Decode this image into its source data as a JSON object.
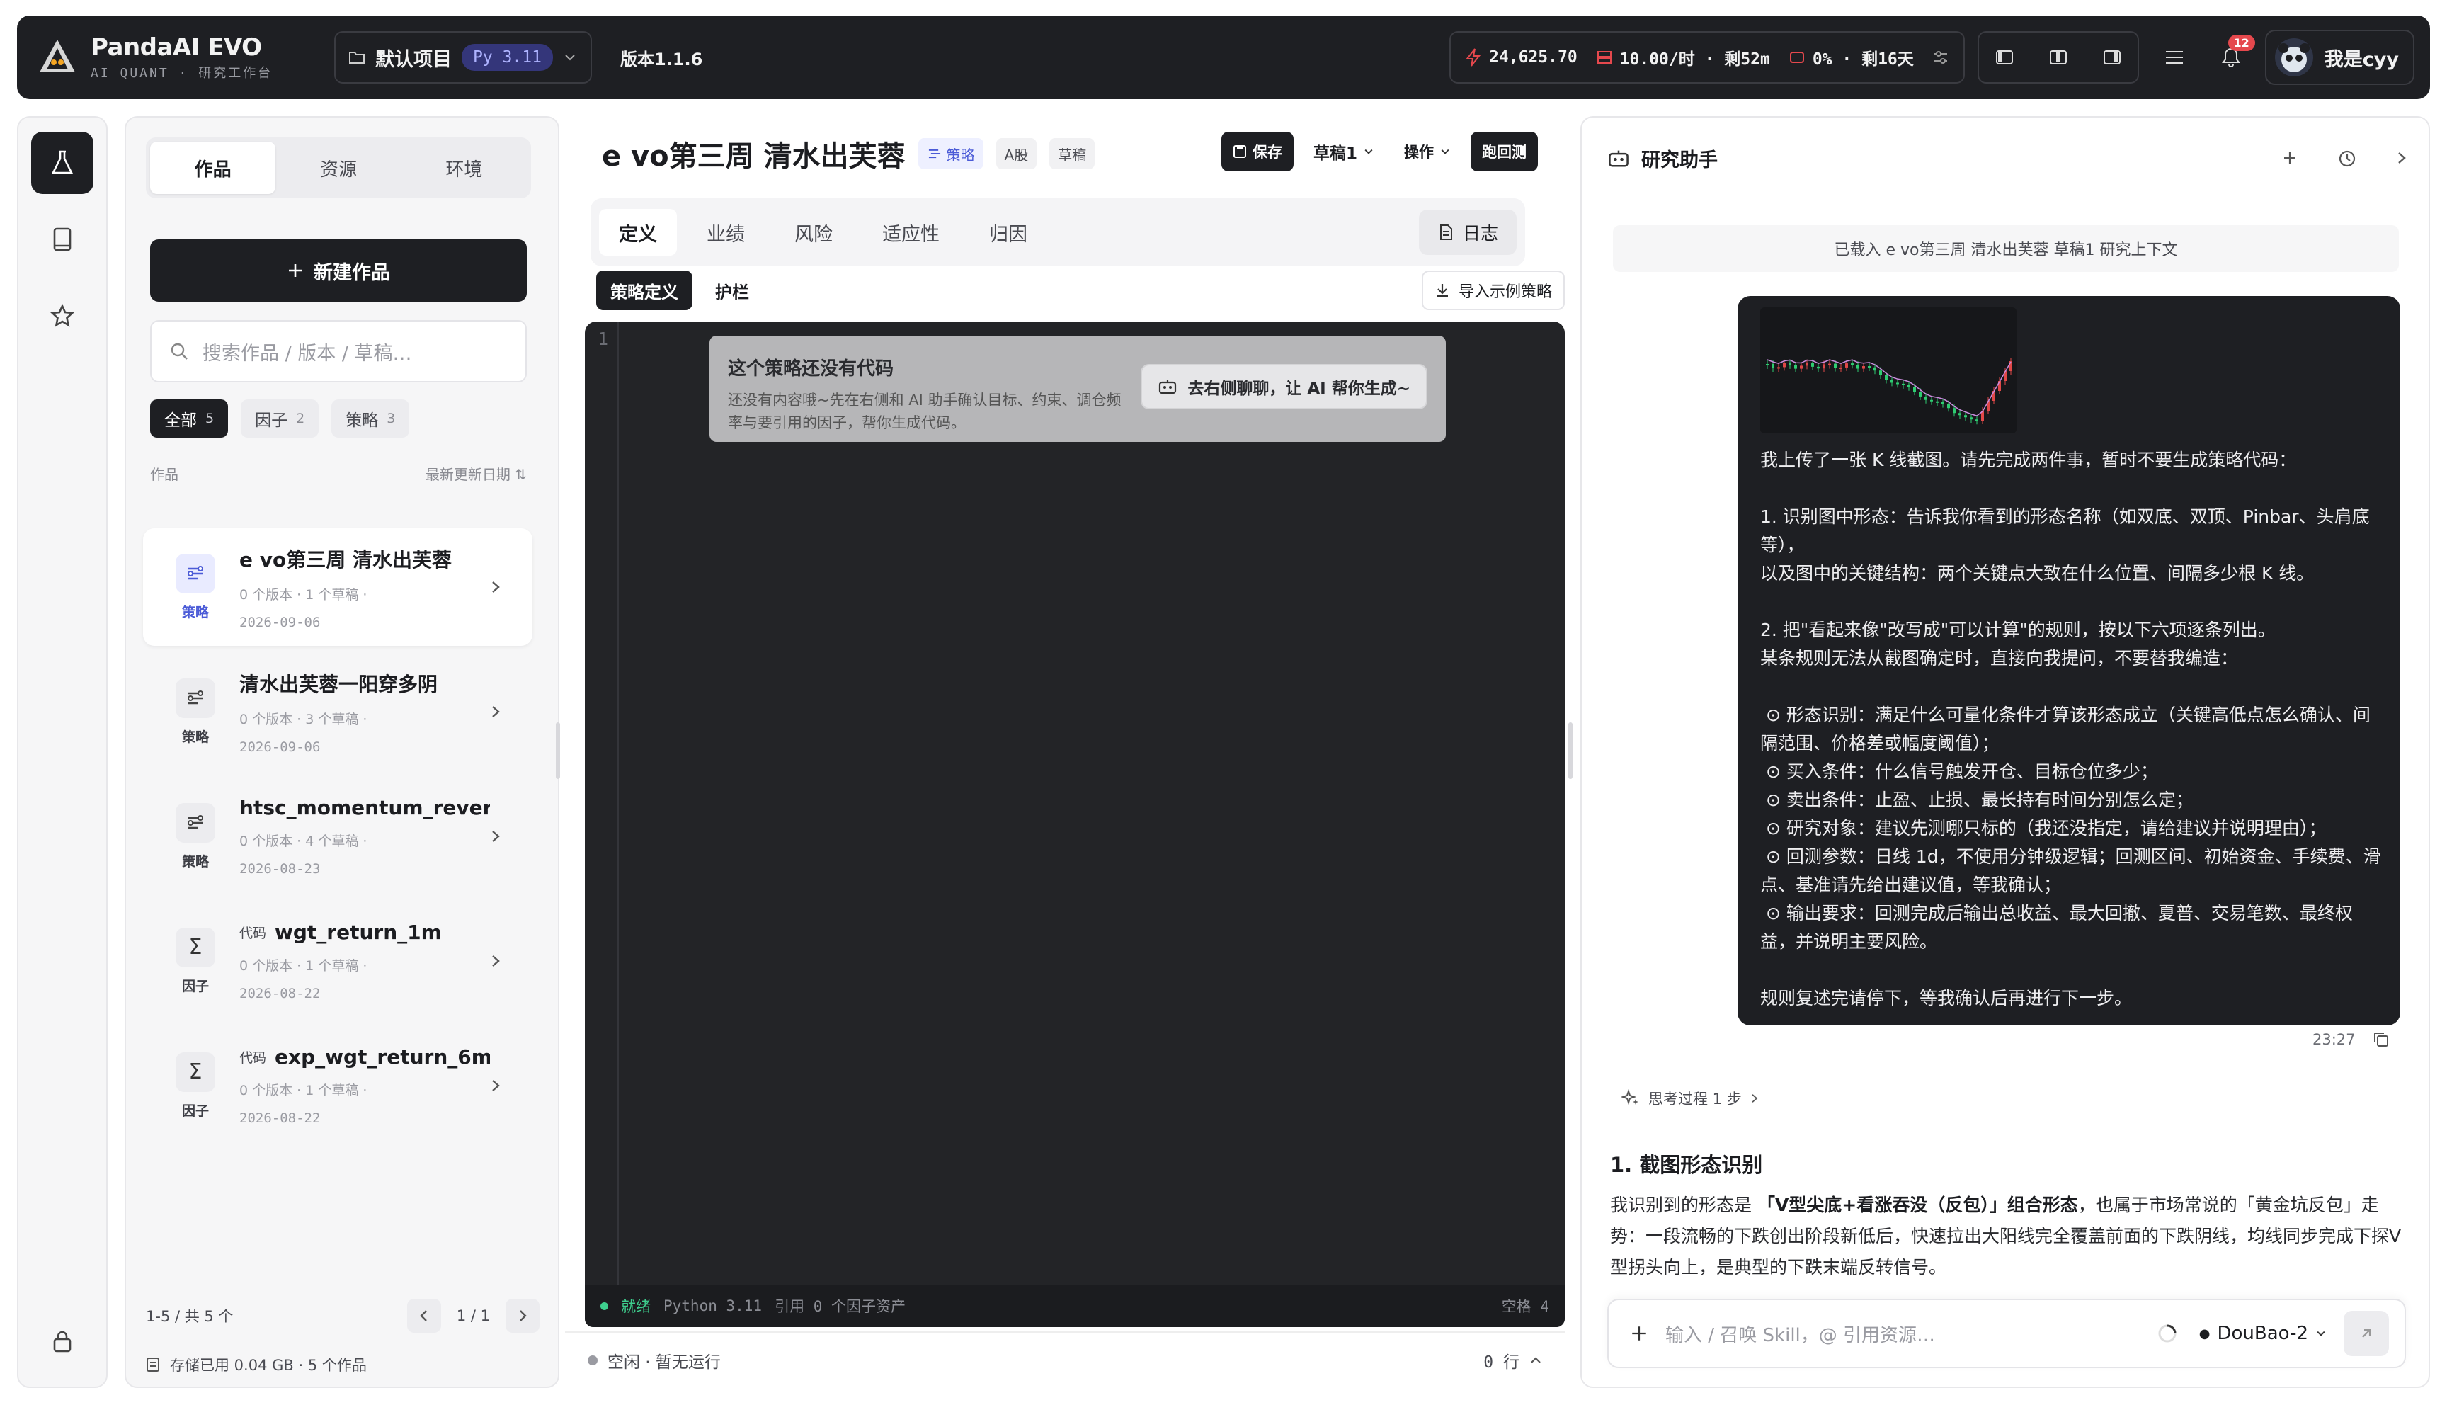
{
  "topbar": {
    "brand_name": "PandaAI EVO",
    "brand_sub": "AI QUANT · 研究工作台",
    "project": "默认项目",
    "python_badge": "Py 3.11",
    "version": "版本1.1.6",
    "stats": {
      "points": "24,625.70",
      "rate": "10.00/时 · 剩52m",
      "usage": "0% · 剩16天"
    },
    "notifications": "12",
    "username": "我是cyy"
  },
  "left": {
    "tabs": [
      "作品",
      "资源",
      "环境"
    ],
    "new_button": "新建作品",
    "search_placeholder": "搜索作品 / 版本 / 草稿…",
    "filters": [
      {
        "label": "全部",
        "count": "5"
      },
      {
        "label": "因子",
        "count": "2"
      },
      {
        "label": "策略",
        "count": "3"
      }
    ],
    "list_header": "作品",
    "sort_label": "最新更新日期",
    "items": [
      {
        "title": "e vo第三周 清水出芙蓉",
        "tag": "",
        "sub": "0 个版本 · 1 个草稿 ·",
        "date": "2026-09-06",
        "kind": "策略",
        "icon": "strategy-icon"
      },
      {
        "title": "清水出芙蓉一阳穿多阴",
        "tag": "",
        "sub": "0 个版本 · 3 个草稿 ·",
        "date": "2026-09-06",
        "kind": "策略",
        "icon": "strategy-icon"
      },
      {
        "title": "htsc_momentum_revers…",
        "tag": "",
        "sub": "0 个版本 · 4 个草稿 ·",
        "date": "2026-08-23",
        "kind": "策略",
        "icon": "strategy-icon"
      },
      {
        "title": "wgt_return_1m",
        "tag": "代码",
        "sub": "0 个版本 · 1 个草稿 ·",
        "date": "2026-08-22",
        "kind": "因子",
        "icon": "sigma-icon"
      },
      {
        "title": "exp_wgt_return_6m",
        "tag": "代码",
        "sub": "0 个版本 · 1 个草稿 ·",
        "date": "2026-08-22",
        "kind": "因子",
        "icon": "sigma-icon"
      }
    ],
    "pager_info": "1-5 / 共 5 个",
    "pager_page": "1 / 1",
    "storage": "存储已用 0.04 GB · 5 个作品"
  },
  "center": {
    "title": "e vo第三周 清水出芙蓉",
    "badges": [
      "策略",
      "A股",
      "草稿"
    ],
    "save": "保存",
    "draft": "草稿1",
    "ops": "操作",
    "run": "跑回测",
    "tabs": [
      "定义",
      "业绩",
      "风险",
      "适应性",
      "归因"
    ],
    "log": "日志",
    "subtabs": [
      "策略定义",
      "护栏"
    ],
    "import": "导入示例策略",
    "line_no": "1",
    "hint_title": "这个策略还没有代码",
    "hint_body": "还没有内容哦~先在右侧和 AI 助手确认目标、约束、调仓频率与要引用的因子，帮你生成代码。",
    "hint_button": "去右侧聊聊，让 AI 帮你生成~",
    "status": {
      "ready": "就绪",
      "python": "Python 3.11",
      "refs": "引用 0 个因子资产",
      "spaces": "空格 4"
    },
    "run_status": "空闲 · 暂无运行",
    "run_lines": "0 行"
  },
  "right": {
    "title": "研究助手",
    "context": "已载入 e vo第三周 清水出芙蓉 草稿1 研究上下文",
    "message": "我上传了一张 K 线截图。请先完成两件事，暂时不要生成策略代码：\n\n1. 识别图中形态：告诉我你看到的形态名称（如双底、双顶、Pinbar、头肩底等），\n以及图中的关键结构：两个关键点大致在什么位置、间隔多少根 K 线。\n\n2. 把\"看起来像\"改写成\"可以计算\"的规则，按以下六项逐条列出。\n某条规则无法从截图确定时，直接向我提问，不要替我编造：\n\n ⊙ 形态识别：满足什么可量化条件才算该形态成立（关键高低点怎么确认、间隔范围、价格差或幅度阈值）；\n ⊙ 买入条件：什么信号触发开仓、目标仓位多少；\n ⊙ 卖出条件：止盈、止损、最长持有时间分别怎么定；\n ⊙ 研究对象：建议先测哪只标的（我还没指定，请给建议并说明理由）；\n ⊙ 回测参数：日线 1d，不使用分钟级逻辑；回测区间、初始资金、手续费、滑点、基准请先给出建议值，等我确认；\n ⊙ 输出要求：回测完成后输出总收益、最大回撤、夏普、交易笔数、最终权益，并说明主要风险。\n\n规则复述完请停下，等我确认后再进行下一步。",
    "time": "23:27",
    "think": "思考过程 1 步",
    "answer_heading": "1. 截图形态识别",
    "answer_pre": "我识别到的形态是 ",
    "answer_bold": "「V型尖底+看涨吞没（反包）」组合形态",
    "answer_post": "，也属于市场常说的「黄金坑反包」走势：一段流畅的下跌创出阶段新低后，快速拉出大阳线完全覆盖前面的下跌阴线，均线同步完成下探V型拐头向上，是典型的下跌末端反转信号。",
    "input_placeholder": "输入 / 召唤 Skill，@ 引用资源…",
    "model": "DouBao-2"
  }
}
